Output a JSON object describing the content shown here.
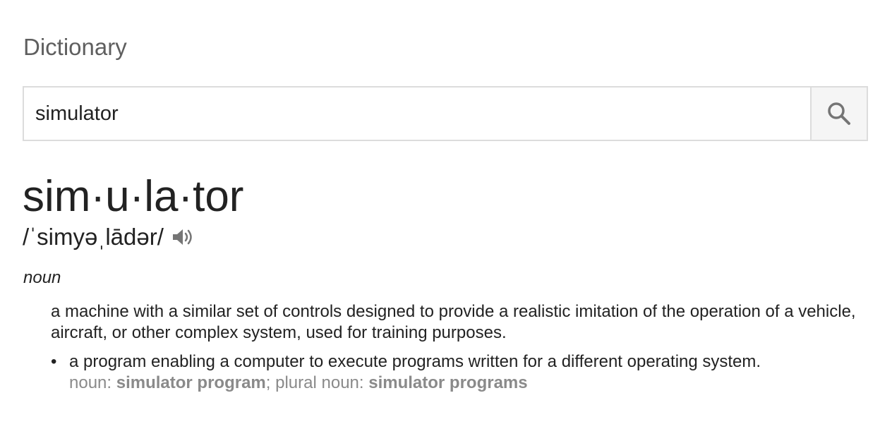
{
  "header": {
    "title": "Dictionary"
  },
  "search": {
    "value": "simulator",
    "button_icon": "search-icon"
  },
  "entry": {
    "headword": "sim·u·la·tor",
    "pronunciation": "/ˈsimyəˌlādər/",
    "audio_icon": "speaker-icon",
    "part_of_speech": "noun",
    "definitions": [
      {
        "text": "a machine with a similar set of controls designed to provide a realistic imitation of the operation of a vehicle, aircraft, or other complex system, used for training purposes."
      },
      {
        "bullet": "•",
        "text": "a program enabling a computer to execute programs written for a different operating system.",
        "forms": {
          "label1": "noun:",
          "term1": "simulator program",
          "sep": ";",
          "label2": "plural noun:",
          "term2": "simulator programs"
        }
      }
    ]
  },
  "colors": {
    "title": "#5f5f5f",
    "text": "#222222",
    "muted": "#8a8a8a",
    "border": "#dcdcdc",
    "button_bg": "#f5f5f5",
    "icon": "#757575"
  }
}
